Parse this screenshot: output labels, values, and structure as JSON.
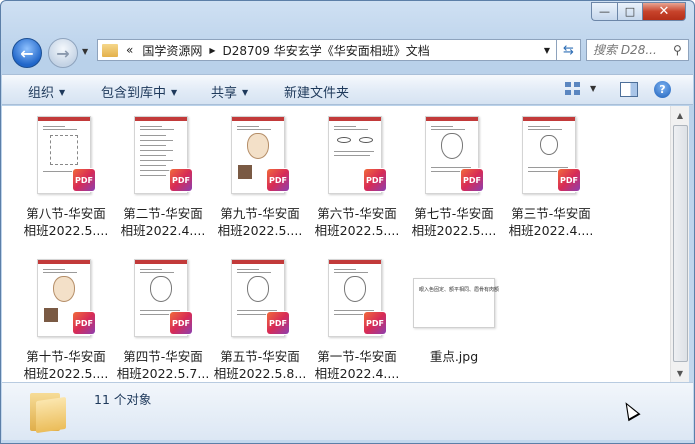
{
  "window": {
    "caption": {
      "minimize": "—",
      "maximize": "□",
      "close": "✕"
    }
  },
  "address": {
    "chevron": "«",
    "crumbs": [
      "国学资源网",
      "D28709 华安玄学《华安面相班》文档"
    ]
  },
  "search": {
    "placeholder": "搜索 D28..."
  },
  "toolbar": {
    "organize": "组织",
    "include_in_library": "包含到库中",
    "share": "共享",
    "new_folder": "新建文件夹",
    "help": "?"
  },
  "files": [
    {
      "line1": "第八节-华安面",
      "line2": "相班2022.5....",
      "type": "pdf",
      "style": "chart"
    },
    {
      "line1": "第二节-华安面",
      "line2": "相班2022.4....",
      "type": "pdf",
      "style": "text"
    },
    {
      "line1": "第九节-华安面",
      "line2": "相班2022.5....",
      "type": "pdf",
      "style": "face-tan"
    },
    {
      "line1": "第六节-华安面",
      "line2": "相班2022.5....",
      "type": "pdf",
      "style": "eyes"
    },
    {
      "line1": "第七节-华安面",
      "line2": "相班2022.5....",
      "type": "pdf",
      "style": "face"
    },
    {
      "line1": "第三节-华安面",
      "line2": "相班2022.4....",
      "type": "pdf",
      "style": "face-small"
    },
    {
      "line1": "第十节-华安面",
      "line2": "相班2022.5....",
      "type": "pdf",
      "style": "face-tan"
    },
    {
      "line1": "第四节-华安面",
      "line2": "相班2022.5.7...",
      "type": "pdf",
      "style": "face"
    },
    {
      "line1": "第五节-华安面",
      "line2": "相班2022.5.8...",
      "type": "pdf",
      "style": "face"
    },
    {
      "line1": "第一节-华安面",
      "line2": "相班2022.4....",
      "type": "pdf",
      "style": "face"
    },
    {
      "line1": "重点.jpg",
      "line2": "",
      "type": "jpg",
      "preview_text": "眼入色固定、额平相同、眉骨有肉额"
    }
  ],
  "pdf_badge": "PDF",
  "status": {
    "count": "11 个对象"
  }
}
